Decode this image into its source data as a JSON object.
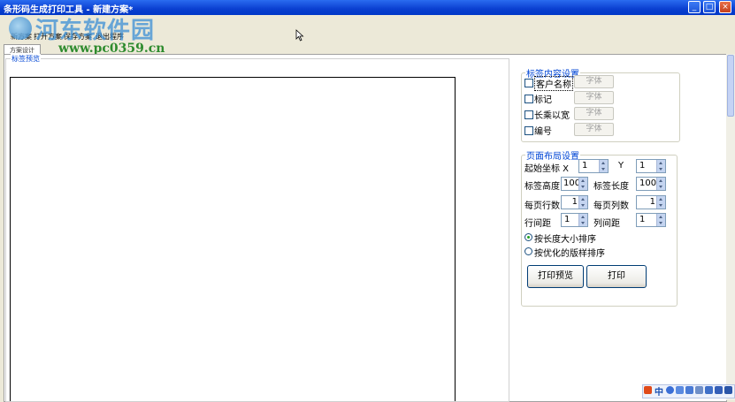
{
  "window": {
    "title": "条形码生成打印工具 - 新建方案*",
    "minimize": "_",
    "maximize": "□",
    "close": "×"
  },
  "watermark": {
    "title": "河东软件园",
    "url": "www.pc0359.cn"
  },
  "menu": {
    "items": [
      "新方案",
      "打开方案",
      "保存方案",
      "退出程序"
    ]
  },
  "tab": {
    "label": "方案设计"
  },
  "preview": {
    "legend": "标签预览"
  },
  "content_settings": {
    "legend": "标签内容设置",
    "font_button": "字体",
    "items": [
      {
        "label": "客户名称",
        "checked": false
      },
      {
        "label": "标记",
        "checked": false
      },
      {
        "label": "长乘以宽",
        "checked": false
      },
      {
        "label": "编号",
        "checked": false
      }
    ]
  },
  "layout_settings": {
    "legend": "页面布局设置",
    "start_label": "起始坐标 X",
    "start_x": "1",
    "y_label": "Y",
    "start_y": "1",
    "label_height_label": "标签高度",
    "label_height": "100",
    "label_length_label": "标签长度",
    "label_length": "100",
    "rows_label": "每页行数",
    "rows": "1",
    "cols_label": "每页列数",
    "cols": "1",
    "row_gap_label": "行间距",
    "row_gap": "1",
    "col_gap_label": "列间距",
    "col_gap": "1",
    "sort_by_length": "按长度大小排序",
    "sort_optimized": "按优化的版样排序",
    "sort_selected": "length"
  },
  "buttons": {
    "print_preview": "打印预览",
    "print": "打印"
  },
  "tray": {
    "lang": "中"
  }
}
